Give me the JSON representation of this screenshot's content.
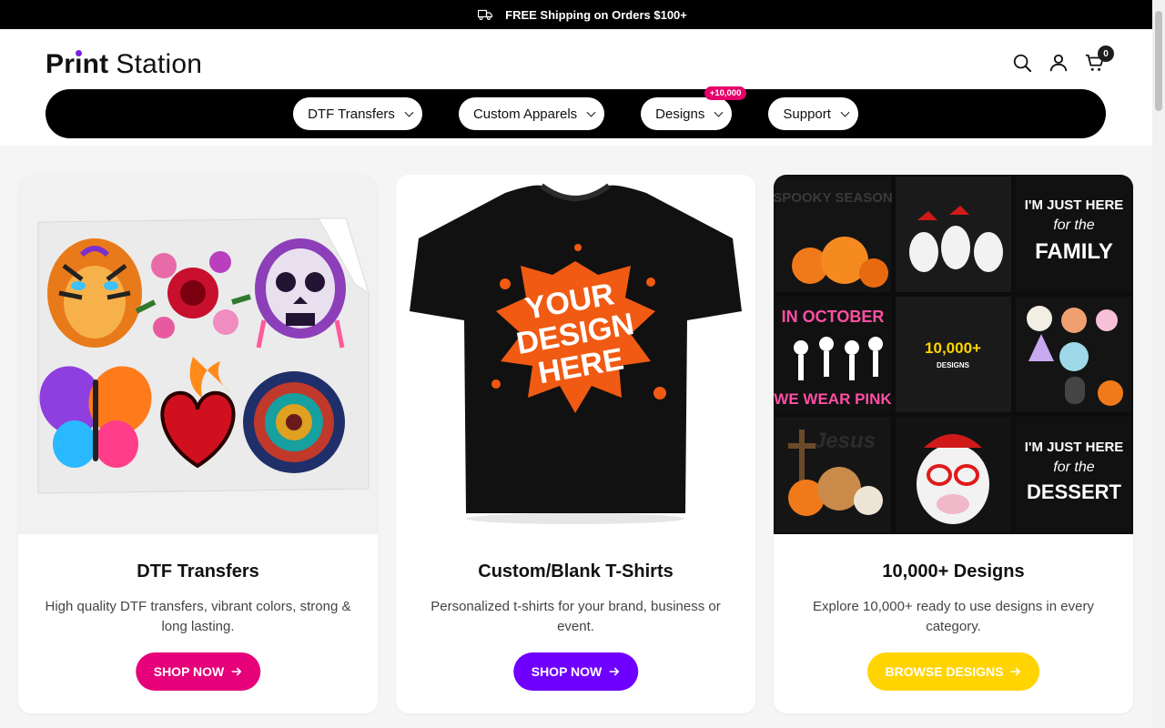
{
  "announcement": {
    "text": "FREE Shipping on Orders $100+",
    "icon": "truck-icon"
  },
  "header": {
    "logo": {
      "bold": "Print",
      "light": "Station"
    },
    "cart_count": "0"
  },
  "nav": {
    "items": [
      {
        "label": "DTF Transfers"
      },
      {
        "label": "Custom Apparels"
      },
      {
        "label": "Designs",
        "badge": "+10,000"
      },
      {
        "label": "Support"
      }
    ]
  },
  "cards": [
    {
      "title": "DTF Transfers",
      "description": "High quality DTF transfers, vibrant colors, strong & long lasting.",
      "button": "SHOP NOW",
      "button_color": "#e6007a"
    },
    {
      "title": "Custom/Blank T-Shirts",
      "description": "Personalized t-shirts for your brand, business or event.",
      "button": "SHOP NOW",
      "button_color": "#6f00ff",
      "image_text": [
        "YOUR",
        "DESIGN",
        "HERE"
      ]
    },
    {
      "title": "10,000+ Designs",
      "description": "Explore 10,000+ ready to use designs in every category.",
      "button": "BROWSE DESIGNS",
      "button_color": "#ffd400",
      "image_text": {
        "center_big": "10,000+",
        "center_small": "DESIGNS",
        "tiles": [
          "SPOOKY SEASON",
          "IN OCTOBER",
          "WE WEAR PINK",
          "Jesus",
          "I'M JUST HERE",
          "for the",
          "FAMILY",
          "DESSERT"
        ]
      }
    }
  ],
  "colors": {
    "announce_bg": "#000000",
    "nav_bg": "#000000",
    "badge": "#e5006a",
    "logo_dot": "#7a1fe0"
  }
}
